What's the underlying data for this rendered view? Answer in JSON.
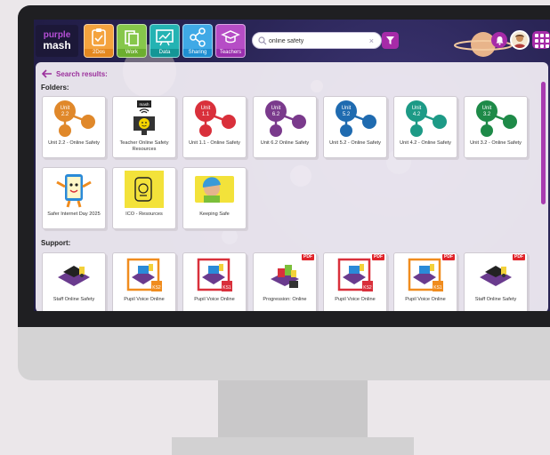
{
  "app": {
    "logo_line1": "purple",
    "logo_line1b": "mash",
    "nav": [
      {
        "label": "2Dos",
        "color": "#f39a2d",
        "icon": "clipboard-icon"
      },
      {
        "label": "Work",
        "color": "#7cbf3b",
        "icon": "folders-icon"
      },
      {
        "label": "Data",
        "color": "#1aa5a5",
        "icon": "chart-board-icon"
      },
      {
        "label": "Sharing",
        "color": "#3aa0e0",
        "icon": "share-icon"
      },
      {
        "label": "Teachers",
        "color": "#b044c0",
        "icon": "mortarboard-icon"
      }
    ],
    "search": {
      "value": "online safety",
      "clear": "×"
    }
  },
  "results": {
    "back_label": "Search results:",
    "folders_heading": "Folders:",
    "support_heading": "Support:",
    "folders": [
      {
        "caption": "Unit 2.2 - Online Safety",
        "unit": "Unit 2.2",
        "color": "#e0882a"
      },
      {
        "caption": "Teacher Online Safety Resources",
        "unit": "",
        "color": ""
      },
      {
        "caption": "Unit 1.1 - Online Safety",
        "unit": "Unit 1.1",
        "color": "#d9303b"
      },
      {
        "caption": "Unit 6.2 Online Safety",
        "unit": "Unit 6.2",
        "color": "#7a3a8c"
      },
      {
        "caption": "Unit 5.2 - Online Safety",
        "unit": "Unit 5.2",
        "color": "#1f6bb0"
      },
      {
        "caption": "Unit 4.2 - Online Safety",
        "unit": "Unit 4.2",
        "color": "#1d9a86"
      },
      {
        "caption": "Unit 3.2 - Online Safety",
        "unit": "Unit 3.2",
        "color": "#1e8a48"
      },
      {
        "caption": "Safer Internet Day 2025",
        "unit": "",
        "color": ""
      },
      {
        "caption": "ICO - Resources",
        "unit": "",
        "color": ""
      },
      {
        "caption": "Keeping Safe",
        "unit": "",
        "color": ""
      }
    ],
    "mash_badge": "mash",
    "support": [
      {
        "caption": "Staff Online Safety",
        "pdf": ""
      },
      {
        "caption": "Pupil Voice Online",
        "pdf": ""
      },
      {
        "caption": "Pupil Voice Online",
        "pdf": ""
      },
      {
        "caption": "Progression: Online",
        "pdf": "PDF"
      },
      {
        "caption": "Pupil Voice Online",
        "pdf": "PDF"
      },
      {
        "caption": "Pupil Voice Online",
        "pdf": "PDF"
      },
      {
        "caption": "Staff Online Safety",
        "pdf": "PDF"
      }
    ],
    "ks_badges": [
      "KS2",
      "KS1",
      "KS2",
      "KS1"
    ]
  }
}
